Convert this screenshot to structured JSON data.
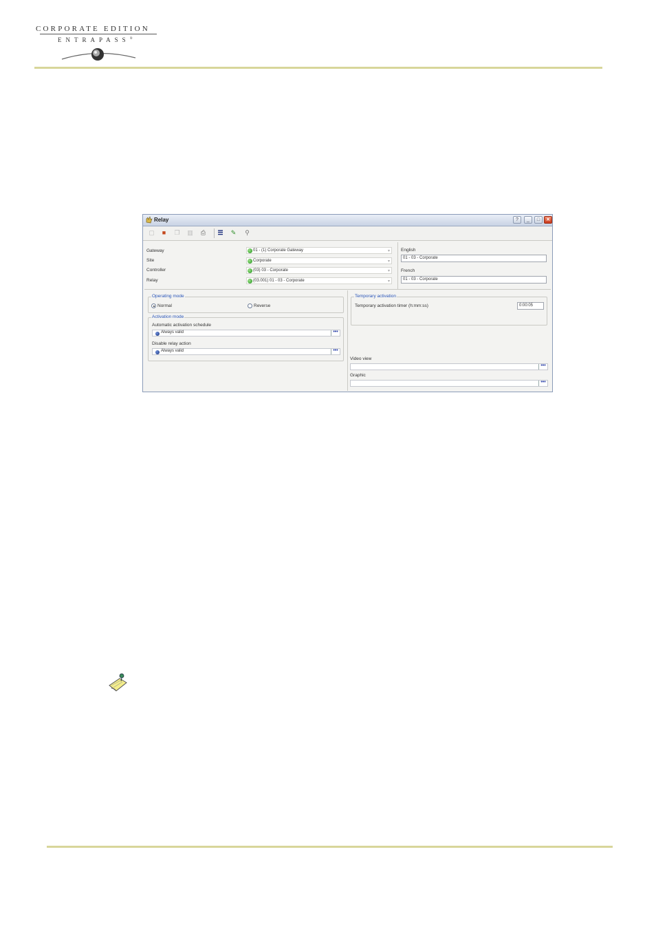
{
  "header": {
    "brand_line1": "CORPORATE EDITION",
    "brand_line2": "ENTRAPASS",
    "trademark": "®"
  },
  "window": {
    "title": "Relay",
    "controls": [
      "help",
      "minimize",
      "maximize",
      "close"
    ],
    "toolbar": [
      "new-icon",
      "save-icon",
      "copy-icon",
      "delete-icon",
      "print-icon",
      "list-icon",
      "link-icon",
      "find-icon"
    ],
    "fields": {
      "gateway": {
        "label": "Gateway",
        "value": "01 - (1)  Corporate Gateway"
      },
      "site": {
        "label": "Site",
        "value": "Corporate"
      },
      "controller": {
        "label": "Controller",
        "value": "(03) 03 - Corporate"
      },
      "relay": {
        "label": "Relay",
        "value": "(03.001) 01 - 03 - Corporate"
      }
    },
    "names": {
      "english_label": "English",
      "english_value": "01 - 03 - Corporate",
      "french_label": "French",
      "french_value": "01 - 03 - Corporate"
    },
    "operating_mode": {
      "title": "Operating mode",
      "normal": "Normal",
      "reverse": "Reverse",
      "selected": "Normal"
    },
    "activation_mode": {
      "title": "Activation mode",
      "auto_label": "Automatic activation schedule",
      "auto_value": "Always valid",
      "disable_label": "Disable relay action",
      "disable_value": "Always valid"
    },
    "temporary_activation": {
      "title": "Temporary activation",
      "timer_label": "Temporary activation timer (h:mm:ss)",
      "timer_value": "0:00:05"
    },
    "video_view_label": "Video view",
    "graphic_label": "Graphic",
    "ellipsis": "•••"
  },
  "note_icon": "note-pad-icon",
  "colors": {
    "rule": "#d8d69a",
    "group_title": "#2a55b8",
    "status_dot": "#1f8f1a"
  }
}
